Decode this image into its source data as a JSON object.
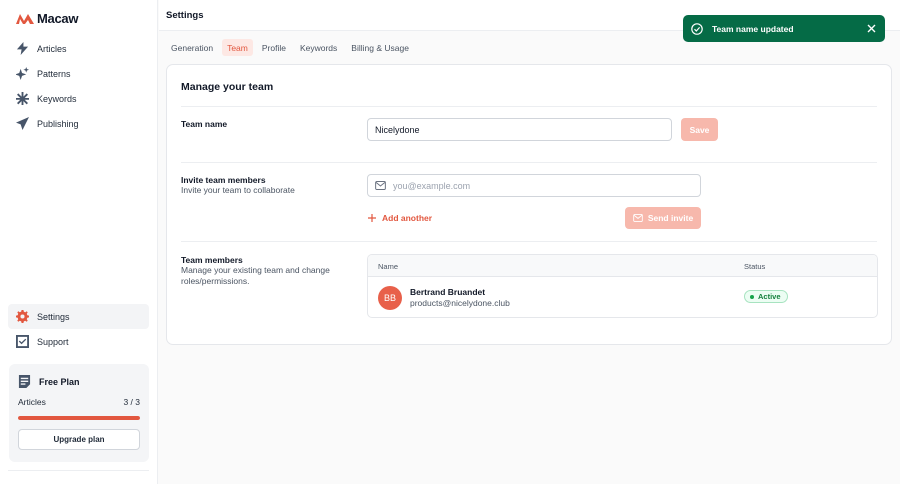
{
  "app": {
    "brand": "Macaw"
  },
  "sidebar": {
    "nav": [
      {
        "label": "Articles",
        "icon": "bolt-icon"
      },
      {
        "label": "Patterns",
        "icon": "sparkles-icon"
      },
      {
        "label": "Keywords",
        "icon": "asterisk-icon"
      },
      {
        "label": "Publishing",
        "icon": "paper-plane-icon"
      }
    ],
    "bottom": [
      {
        "label": "Settings",
        "icon": "gear-icon",
        "active": true
      },
      {
        "label": "Support",
        "icon": "support-icon"
      }
    ],
    "plan": {
      "name": "Free Plan",
      "usage_label": "Articles",
      "usage_value": "3 / 3",
      "usage_fraction": 1.0,
      "upgrade_label": "Upgrade plan"
    }
  },
  "header": {
    "title": "Settings"
  },
  "tabs": [
    {
      "label": "Generation"
    },
    {
      "label": "Team",
      "active": true
    },
    {
      "label": "Profile"
    },
    {
      "label": "Keywords"
    },
    {
      "label": "Billing & Usage"
    }
  ],
  "team": {
    "title": "Manage your team",
    "name_section": {
      "label": "Team name",
      "value": "Nicelydone",
      "save_label": "Save"
    },
    "invite_section": {
      "label": "Invite team members",
      "description": "Invite your team to collaborate",
      "email_placeholder": "you@example.com",
      "add_another_label": "Add another",
      "send_label": "Send invite"
    },
    "members_section": {
      "label": "Team members",
      "description": "Manage your existing team and change roles/permissions.",
      "columns": {
        "name": "Name",
        "status": "Status"
      },
      "rows": [
        {
          "initials": "BB",
          "name": "Bertrand Bruandet",
          "email": "products@nicelydone.club",
          "status": "Active"
        }
      ]
    }
  },
  "toast": {
    "message": "Team name updated"
  },
  "colors": {
    "accent": "#e2573f",
    "toast_bg": "#056b46",
    "success": "#16a34a"
  }
}
